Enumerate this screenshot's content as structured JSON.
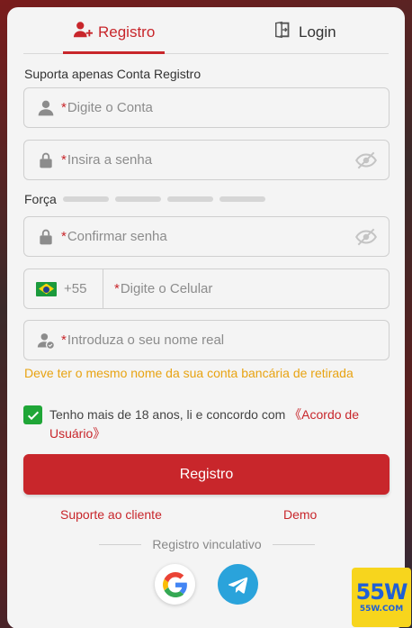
{
  "tabs": {
    "register_label": "Registro",
    "login_label": "Login"
  },
  "form": {
    "hint": "Suporta apenas Conta Registro",
    "required_marker": "*",
    "account_placeholder": "Digite o Conta",
    "password_placeholder": "Insira a senha",
    "strength_label": "Força",
    "confirm_placeholder": "Confirmar senha",
    "phone_code": "+55",
    "phone_placeholder": "Digite o Celular",
    "realname_placeholder": "Introduza o seu nome real",
    "realname_warning": "Deve ter o mesmo nome da sua conta bancária de retirada",
    "agree_text": "Tenho mais de 18 anos, li e concordo com ",
    "agree_link": "《Acordo de Usuário》",
    "agree_checked": true,
    "submit_label": "Registro"
  },
  "links": {
    "support": "Suporte ao cliente",
    "demo": "Demo"
  },
  "social": {
    "divider_text": "Registro vinculativo",
    "providers": [
      "google-icon",
      "telegram-icon"
    ]
  },
  "watermark": {
    "big": "55W",
    "small": "55W.COM"
  },
  "colors": {
    "accent": "#c8262b",
    "warning": "#e8a312",
    "checkbox": "#1fa637",
    "telegram": "#2aa3db"
  }
}
